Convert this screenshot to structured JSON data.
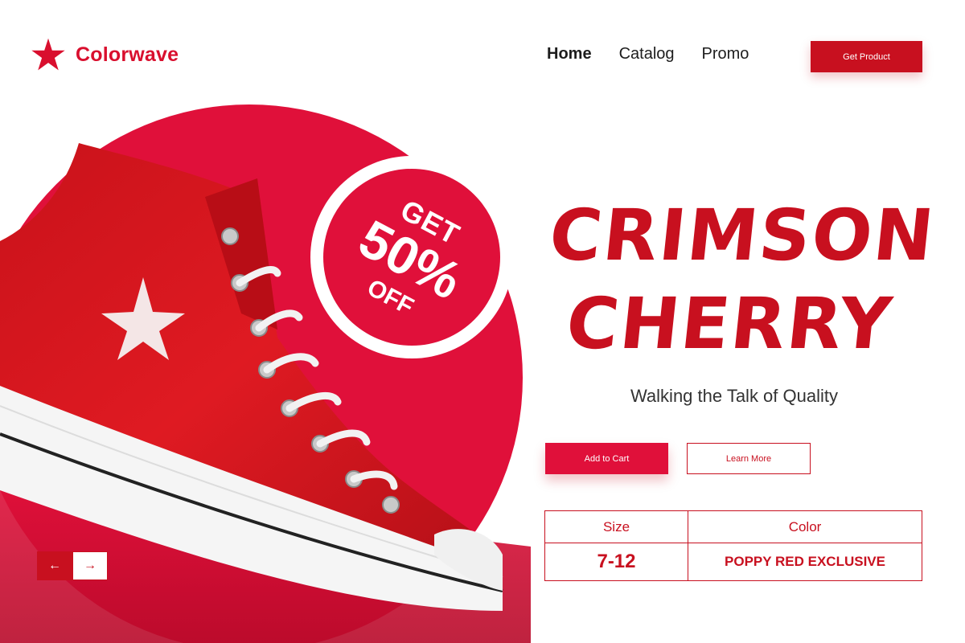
{
  "brand": {
    "name": "Colorwave"
  },
  "nav": {
    "items": [
      "Home",
      "Catalog",
      "Promo"
    ],
    "cta": "Get Product"
  },
  "promo": {
    "get": "GET",
    "percent": "50%",
    "off": "OFF"
  },
  "hero": {
    "title_line1": "CRIMSON",
    "title_line2": "CHERRY",
    "subtitle": "Walking the Talk of Quality",
    "add_to_cart": "Add to Cart",
    "learn_more": "Learn More"
  },
  "specs": {
    "headers": [
      "Size",
      "Color"
    ],
    "values": [
      "7-12",
      "POPPY RED EXCLUSIVE"
    ]
  },
  "carousel": {
    "prev_icon": "←",
    "next_icon": "→"
  },
  "colors": {
    "accent": "#c8101f",
    "hero_red": "#e0103a",
    "shoe_red": "#d3141c"
  }
}
